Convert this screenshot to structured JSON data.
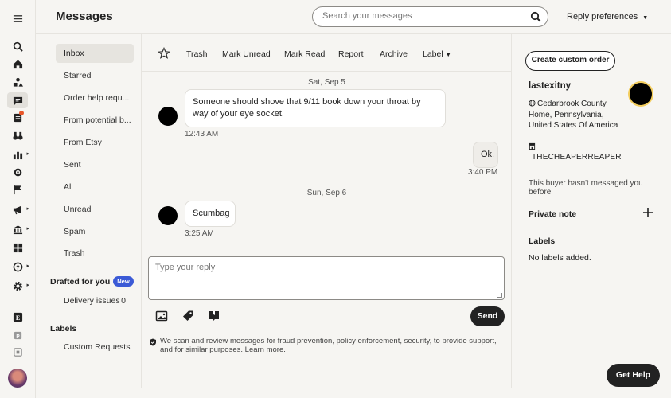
{
  "header": {
    "title": "Messages",
    "search_placeholder": "Search your messages",
    "reply_preferences": "Reply preferences"
  },
  "folders": {
    "items": [
      {
        "label": "Inbox",
        "active": true
      },
      {
        "label": "Starred"
      },
      {
        "label": "Order help requ..."
      },
      {
        "label": "From potential b..."
      },
      {
        "label": "From Etsy"
      },
      {
        "label": "Sent"
      },
      {
        "label": "All"
      },
      {
        "label": "Unread"
      },
      {
        "label": "Spam"
      },
      {
        "label": "Trash"
      }
    ],
    "drafted_title": "Drafted for you",
    "new_badge": "New",
    "delivery_issues": {
      "label": "Delivery issues",
      "count": "0"
    },
    "labels_title": "Labels",
    "custom_requests": "Custom Requests"
  },
  "toolbar": {
    "trash": "Trash",
    "mark_unread": "Mark Unread",
    "mark_read": "Mark Read",
    "report": "Report",
    "archive": "Archive",
    "label": "Label"
  },
  "conversation": {
    "date1": "Sat, Sep 5",
    "msg1": {
      "text": "Someone should shove that 9/11 book down your throat by way of your eye socket.",
      "time": "12:43 AM"
    },
    "msg2": {
      "text": "Ok.",
      "time": "3:40 PM"
    },
    "date2": "Sun, Sep 6",
    "msg3": {
      "text": "Scumbag",
      "time": "3:25 AM"
    }
  },
  "reply": {
    "placeholder": "Type your reply",
    "send": "Send",
    "notice": "We scan and review messages for fraud prevention, policy enforcement, security, to provide support, and for similar purposes.",
    "learn_more": "Learn more"
  },
  "details": {
    "create_custom_order": "Create custom order",
    "buyer": "lastexitny",
    "location": "Cedarbrook County Home, Pennsylvania, United States Of America",
    "shop": "THECHEAPERREAPER",
    "no_messages": "This buyer hasn't messaged you before",
    "private_note": "Private note",
    "labels_title": "Labels",
    "no_labels": "No labels added."
  },
  "get_help": "Get Help"
}
